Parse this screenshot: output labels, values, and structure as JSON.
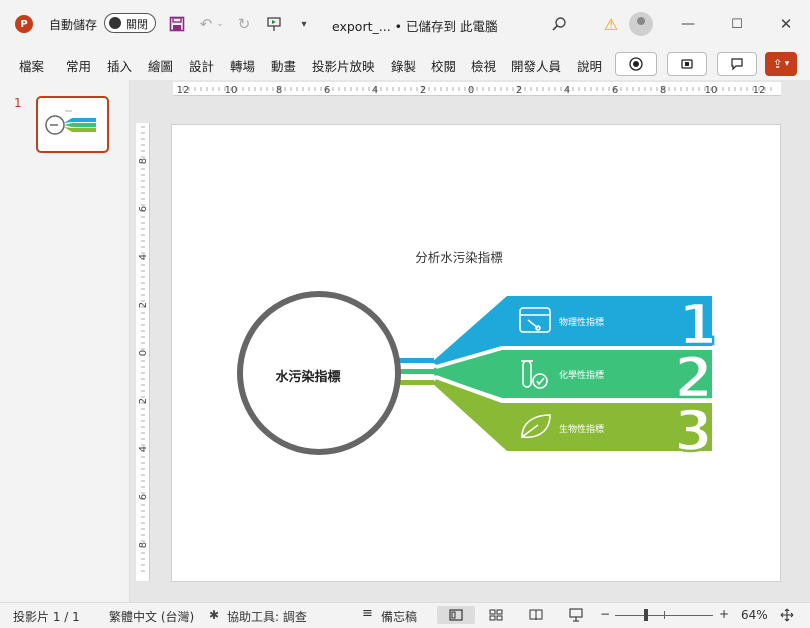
{
  "app": {
    "logo_letter": "P",
    "autosave_label": "自動儲存",
    "autosave_state": "關閉",
    "doc_title": "export_... • 已儲存到 此電腦"
  },
  "ribbon": {
    "tabs": [
      "檔案",
      "常用",
      "插入",
      "繪圖",
      "設計",
      "轉場",
      "動畫",
      "投影片放映",
      "錄製",
      "校閱",
      "檢視",
      "開發人員",
      "說明"
    ]
  },
  "thumbnail": {
    "number": "1"
  },
  "rulers": {
    "horizontal": [
      "12",
      "10",
      "8",
      "6",
      "4",
      "2",
      "0",
      "2",
      "4",
      "6",
      "8",
      "10",
      "12"
    ],
    "vertical": [
      "8",
      "6",
      "4",
      "2",
      "0",
      "2",
      "4",
      "6",
      "8"
    ]
  },
  "slide": {
    "title": "分析水污染指標",
    "center_label": "水污染指標",
    "items": [
      {
        "number": "1",
        "label": "物理性指標",
        "color": "#1fa9db",
        "icon": "computer-icon"
      },
      {
        "number": "2",
        "label": "化學性指標",
        "color": "#3dc27c",
        "icon": "test-tube-icon"
      },
      {
        "number": "3",
        "label": "生物性指標",
        "color": "#8ab936",
        "icon": "leaf-icon"
      }
    ],
    "circle_color": "#666666"
  },
  "status": {
    "slide_info": "投影片 1 / 1",
    "language": "繁體中文 (台灣)",
    "accessibility": "協助工具: 調查",
    "notes": "備忘稿",
    "zoom": "64%"
  },
  "colors": {
    "accent": "#c43e1c"
  }
}
